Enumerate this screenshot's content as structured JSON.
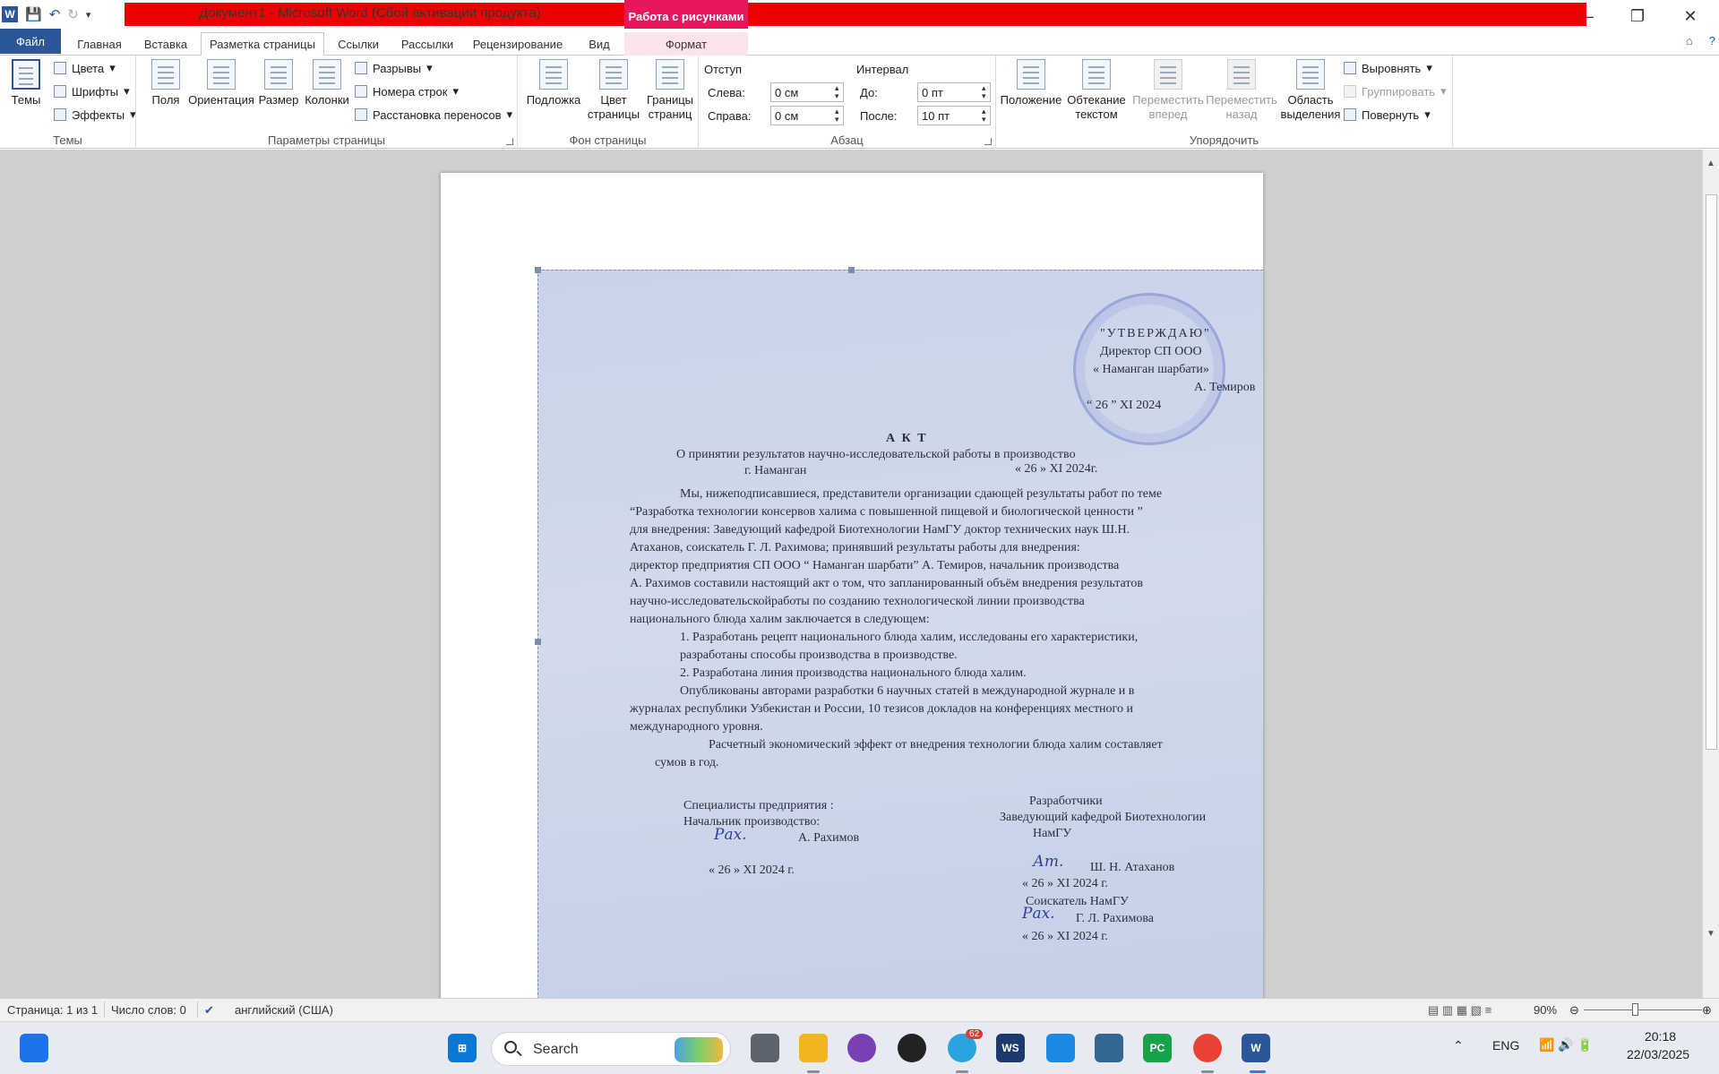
{
  "window": {
    "title": "Документ1 - Microsoft Word (Сбой активации продукта)",
    "context_tab_title": "Работа с рисунками",
    "controls": [
      "–",
      "❐",
      "✕"
    ]
  },
  "qat": {
    "logo": "W",
    "save": "💾",
    "undo": "↶",
    "redo": "↻",
    "more": "▾"
  },
  "tabs": {
    "file": "Файл",
    "items": [
      "Главная",
      "Вставка",
      "Разметка страницы",
      "Ссылки",
      "Рассылки",
      "Рецензирование",
      "Вид"
    ],
    "context": "Формат",
    "right": [
      "⌂",
      "?"
    ]
  },
  "ribbon": {
    "themes": {
      "label": "Темы",
      "big": "Темы",
      "colors": "Цвета",
      "fonts": "Шрифты",
      "effects": "Эффекты"
    },
    "page_setup": {
      "label": "Параметры страницы",
      "margins": "Поля",
      "orientation": "Ориентация",
      "size": "Размер",
      "columns": "Колонки",
      "breaks": "Разрывы",
      "line_numbers": "Номера строк",
      "hyphenation": "Расстановка переносов"
    },
    "page_background": {
      "label": "Фон страницы",
      "watermark": "Подложка",
      "page_color_1": "Цвет",
      "page_color_2": "страницы",
      "page_borders_1": "Границы",
      "page_borders_2": "страниц"
    },
    "paragraph": {
      "label": "Абзац",
      "indent_title": "Отступ",
      "indent_left_label": "Слева:",
      "indent_left": "0 см",
      "indent_right_label": "Справа:",
      "indent_right": "0 см",
      "spacing_title": "Интервал",
      "spacing_before_label": "До:",
      "spacing_before": "0 пт",
      "spacing_after_label": "После:",
      "spacing_after": "10 пт"
    },
    "arrange": {
      "label": "Упорядочить",
      "position": "Положение",
      "wrap_1": "Обтекание",
      "wrap_2": "текстом",
      "forward_1": "Переместить",
      "forward_2": "вперед",
      "backward_1": "Переместить",
      "backward_2": "назад",
      "selection_1": "Область",
      "selection_2": "выделения",
      "align": "Выровнять",
      "group": "Группировать",
      "rotate": "Повернуть"
    }
  },
  "scan": {
    "stamp_lines": [
      "\"УТВЕРЖДАЮ\"",
      "Директор СП ООО",
      "« Наманган шарбати»",
      "А. Темиров",
      "“ 26 ”     XI            2024"
    ],
    "title": "А К Т",
    "subtitle": "О принятии результатов научно-исследовательской работы в производство",
    "city": "г. Наманган",
    "date_top": "« 26 »    XI         2024г.",
    "body": [
      "Мы, нижеподписавшиеся, представители организации сдающей результаты работ по теме",
      "“Разработка технологии консервов халима с  повышенной пищевой и биологической ценности ”",
      "для внедрения: Заведующий кафедрой Биотехнологии    НамГУ  доктор технических наук Ш.Н.",
      "Атаханов, соискатель  Г. Л. Рахимова; принявший результаты работы для внедрения:",
      " директор предприятия СП  ООО “ Наманган шарбати” А.  Темиров, начальник производства",
      "А. Рахимов составили настоящий акт о том, что запланированный объём внедрения результатов",
      "научно-исследовательскойработы по созданию технологической линии производства",
      "национального блюда халим заключается в следующем:"
    ],
    "list": [
      "1.     Разработань рецепт  национального блюда халим, исследованы его характеристики,",
      "         разработаны способы производства в производстве.",
      "2.     Разработана линия производства национального блюда халим."
    ],
    "body2": [
      "Опубликованы авторами разработки 6 научных статей в международной журнале и в",
      "журналах республики Узбекистан и России, 10 тезисов докладов на конференциях местного и",
      "международного уровня.",
      "Расчетный экономический эффект от внедрения технологии блюда халим составляет",
      "сумов  в год."
    ],
    "left_sign": [
      "Специалисты предприятия :",
      "Начальник производство:",
      "А. Рахимов",
      "« 26 »    XI            2024 г."
    ],
    "right_sign": [
      "Разработчики",
      "Заведующий кафедрой Биотехнологии",
      "НамГУ",
      "Ш. Н. Атаханов",
      "« 26 »     XI            2024 г.",
      "Соискатель  НамГУ",
      "Г. Л. Рахимова",
      "« 26 »     XI            2024 г."
    ],
    "sig_marks": [
      "Рах.",
      "Ат.",
      "Рах."
    ]
  },
  "status": {
    "page": "Страница: 1 из 1",
    "words": "Число слов: 0",
    "lang": "английский (США)",
    "zoom": "90%"
  },
  "taskbar": {
    "search": "Search",
    "lang": "ENG",
    "time": "20:18",
    "date": "22/03/2025",
    "telegram_badge": "62"
  }
}
